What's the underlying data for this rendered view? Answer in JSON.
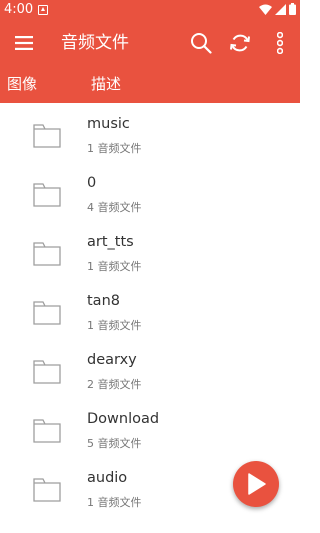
{
  "status_bar": {
    "time": "4:00",
    "icons": [
      "notification-icon",
      "wifi-icon",
      "signal-icon",
      "battery-icon"
    ]
  },
  "toolbar": {
    "title": "音频文件",
    "icons": [
      "menu-icon",
      "search-icon",
      "refresh-icon",
      "more-vert-icon"
    ]
  },
  "tabs": [
    {
      "label": "图像"
    },
    {
      "label": "描述"
    }
  ],
  "folders": [
    {
      "name": "music",
      "count": "1 音频文件"
    },
    {
      "name": "0",
      "count": "4 音频文件"
    },
    {
      "name": "art_tts",
      "count": "1 音频文件"
    },
    {
      "name": "tan8",
      "count": "1 音频文件"
    },
    {
      "name": "dearxy",
      "count": "2 音频文件"
    },
    {
      "name": "Download",
      "count": "5 音频文件"
    },
    {
      "name": "audio",
      "count": "1 音频文件"
    }
  ],
  "fab": {
    "icon": "play-icon"
  },
  "colors": {
    "accent": "#e9523f",
    "folder": "#9e9e9e",
    "text": "#333333",
    "subtext": "#777777"
  }
}
